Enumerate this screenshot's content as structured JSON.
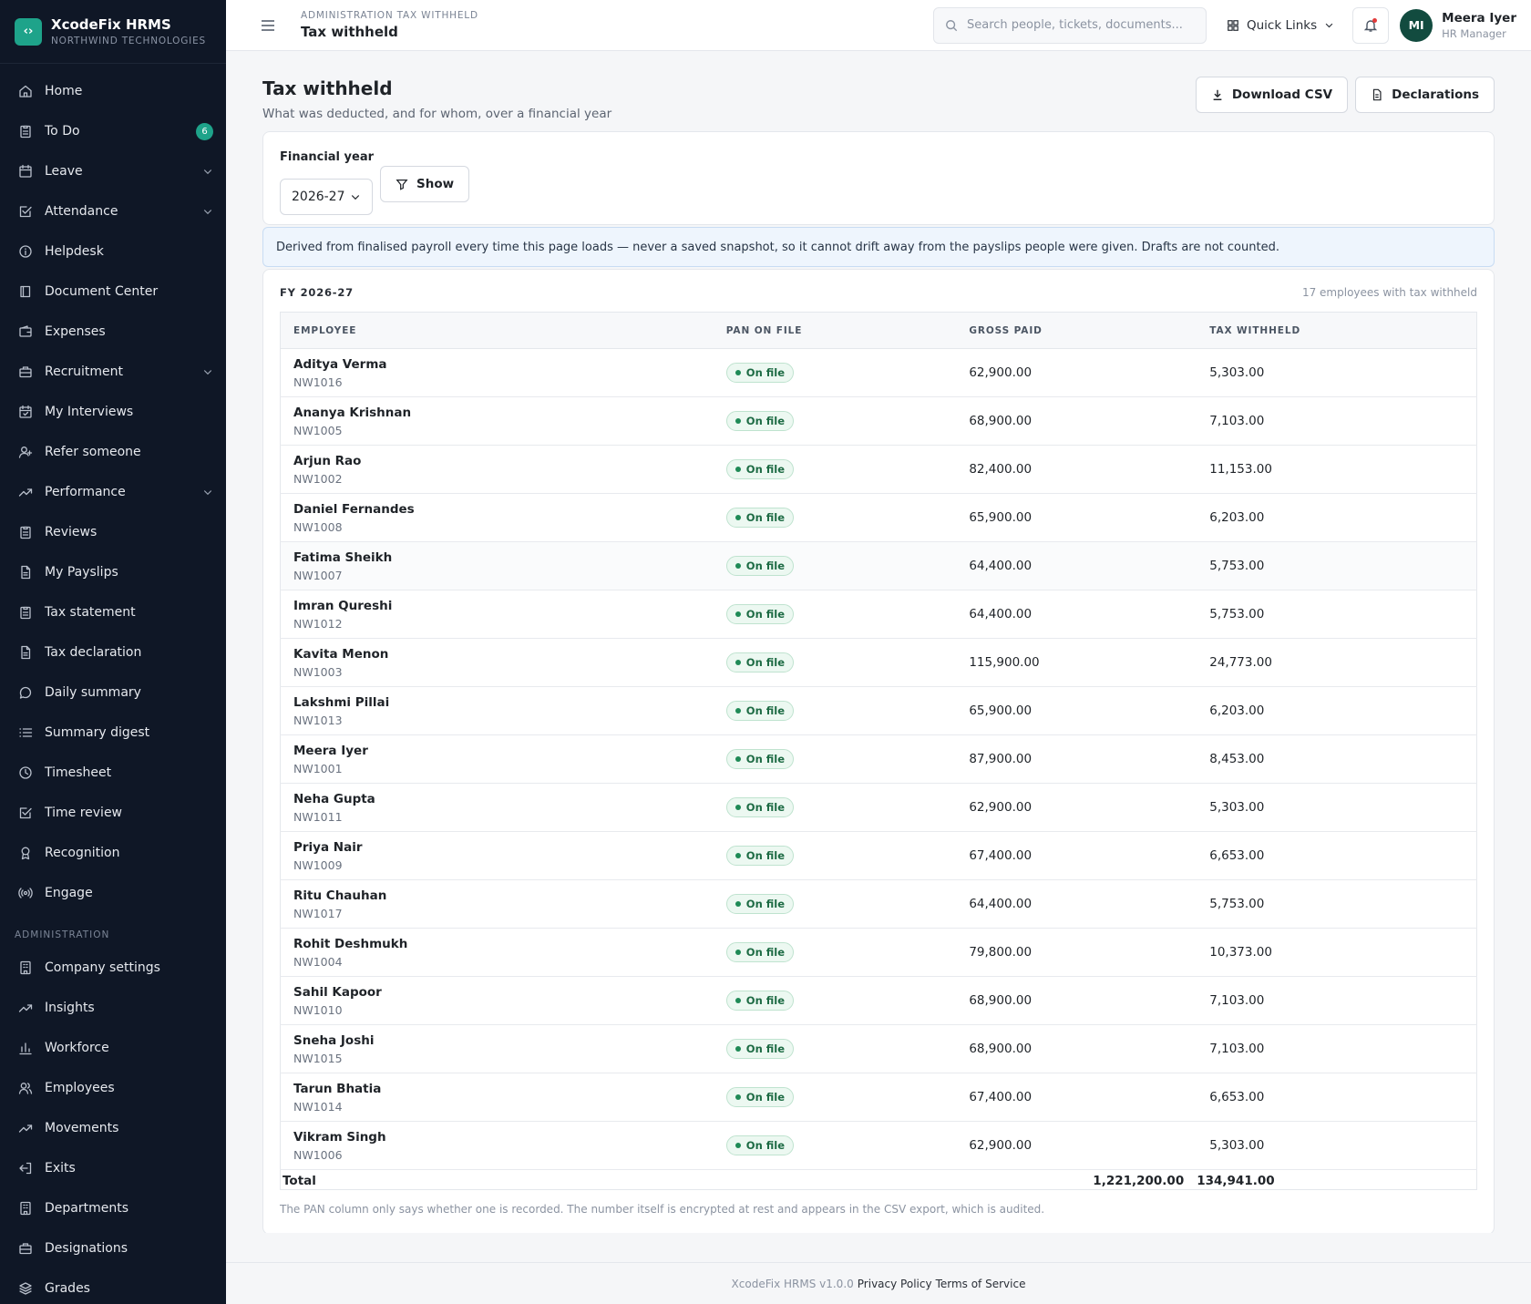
{
  "brand": {
    "logo": "‹›",
    "name": "XcodeFix HRMS",
    "org": "NORTHWIND TECHNOLOGIES"
  },
  "sidebar": {
    "items": [
      {
        "label": "Home",
        "icon": "home-icon"
      },
      {
        "label": "To Do",
        "icon": "clipboard-icon",
        "badge": "6"
      },
      {
        "label": "Leave",
        "icon": "calendar-icon",
        "chevron": true
      },
      {
        "label": "Attendance",
        "icon": "check-square-icon",
        "chevron": true
      },
      {
        "label": "Helpdesk",
        "icon": "info-icon"
      },
      {
        "label": "Document Center",
        "icon": "book-icon"
      },
      {
        "label": "Expenses",
        "icon": "wallet-icon"
      },
      {
        "label": "Recruitment",
        "icon": "briefcase-icon",
        "chevron": true
      },
      {
        "label": "My Interviews",
        "icon": "calendar-check-icon"
      },
      {
        "label": "Refer someone",
        "icon": "user-plus-icon"
      },
      {
        "label": "Performance",
        "icon": "trend-icon",
        "chevron": true
      },
      {
        "label": "Reviews",
        "icon": "clipboard-icon"
      },
      {
        "label": "My Payslips",
        "icon": "file-icon"
      },
      {
        "label": "Tax statement",
        "icon": "clipboard-icon"
      },
      {
        "label": "Tax declaration",
        "icon": "file-icon"
      },
      {
        "label": "Daily summary",
        "icon": "chat-icon"
      },
      {
        "label": "Summary digest",
        "icon": "list-icon"
      },
      {
        "label": "Timesheet",
        "icon": "clock-icon"
      },
      {
        "label": "Time review",
        "icon": "check-square-icon"
      },
      {
        "label": "Recognition",
        "icon": "award-icon"
      },
      {
        "label": "Engage",
        "icon": "broadcast-icon"
      }
    ],
    "admin_section": "ADMINISTRATION",
    "admin_items": [
      {
        "label": "Company settings",
        "icon": "building-icon"
      },
      {
        "label": "Insights",
        "icon": "trend-icon"
      },
      {
        "label": "Workforce",
        "icon": "bar-chart-icon"
      },
      {
        "label": "Employees",
        "icon": "users-icon"
      },
      {
        "label": "Movements",
        "icon": "trend-icon"
      },
      {
        "label": "Exits",
        "icon": "exit-icon"
      },
      {
        "label": "Departments",
        "icon": "building-icon"
      },
      {
        "label": "Designations",
        "icon": "briefcase-icon"
      },
      {
        "label": "Grades",
        "icon": "layers-icon"
      }
    ]
  },
  "topbar": {
    "crumb": "ADMINISTRATION TAX WITHHELD",
    "title": "Tax withheld",
    "search_placeholder": "Search people, tickets, documents...",
    "quick_links": "Quick Links",
    "user_initials": "MI",
    "user_name": "Meera Iyer",
    "user_role": "HR Manager"
  },
  "page": {
    "title": "Tax withheld",
    "subtitle": "What was deducted, and for whom, over a financial year",
    "download_csv": "Download CSV",
    "declarations": "Declarations"
  },
  "filter": {
    "label": "Financial year",
    "selected": "2026-27",
    "show": "Show"
  },
  "notice": "Derived from finalised payroll every time this page loads — never a saved snapshot, so it cannot drift away from the payslips people were given. Drafts are not counted.",
  "table": {
    "fy_label": "FY 2026-27",
    "count": "17 employees with tax withheld",
    "columns": [
      "EMPLOYEE",
      "PAN ON FILE",
      "GROSS PAID",
      "TAX WITHHELD"
    ],
    "rows": [
      {
        "name": "Aditya Verma",
        "id": "NW1016",
        "pan": "On file",
        "gross": "62,900.00",
        "tax": "5,303.00"
      },
      {
        "name": "Ananya Krishnan",
        "id": "NW1005",
        "pan": "On file",
        "gross": "68,900.00",
        "tax": "7,103.00"
      },
      {
        "name": "Arjun Rao",
        "id": "NW1002",
        "pan": "On file",
        "gross": "82,400.00",
        "tax": "11,153.00"
      },
      {
        "name": "Daniel Fernandes",
        "id": "NW1008",
        "pan": "On file",
        "gross": "65,900.00",
        "tax": "6,203.00"
      },
      {
        "name": "Fatima Sheikh",
        "id": "NW1007",
        "pan": "On file",
        "gross": "64,400.00",
        "tax": "5,753.00"
      },
      {
        "name": "Imran Qureshi",
        "id": "NW1012",
        "pan": "On file",
        "gross": "64,400.00",
        "tax": "5,753.00"
      },
      {
        "name": "Kavita Menon",
        "id": "NW1003",
        "pan": "On file",
        "gross": "115,900.00",
        "tax": "24,773.00"
      },
      {
        "name": "Lakshmi Pillai",
        "id": "NW1013",
        "pan": "On file",
        "gross": "65,900.00",
        "tax": "6,203.00"
      },
      {
        "name": "Meera Iyer",
        "id": "NW1001",
        "pan": "On file",
        "gross": "87,900.00",
        "tax": "8,453.00"
      },
      {
        "name": "Neha Gupta",
        "id": "NW1011",
        "pan": "On file",
        "gross": "62,900.00",
        "tax": "5,303.00"
      },
      {
        "name": "Priya Nair",
        "id": "NW1009",
        "pan": "On file",
        "gross": "67,400.00",
        "tax": "6,653.00"
      },
      {
        "name": "Ritu Chauhan",
        "id": "NW1017",
        "pan": "On file",
        "gross": "64,400.00",
        "tax": "5,753.00"
      },
      {
        "name": "Rohit Deshmukh",
        "id": "NW1004",
        "pan": "On file",
        "gross": "79,800.00",
        "tax": "10,373.00"
      },
      {
        "name": "Sahil Kapoor",
        "id": "NW1010",
        "pan": "On file",
        "gross": "68,900.00",
        "tax": "7,103.00"
      },
      {
        "name": "Sneha Joshi",
        "id": "NW1015",
        "pan": "On file",
        "gross": "68,900.00",
        "tax": "7,103.00"
      },
      {
        "name": "Tarun Bhatia",
        "id": "NW1014",
        "pan": "On file",
        "gross": "67,400.00",
        "tax": "6,653.00"
      },
      {
        "name": "Vikram Singh",
        "id": "NW1006",
        "pan": "On file",
        "gross": "62,900.00",
        "tax": "5,303.00"
      }
    ],
    "total_label": "Total",
    "total_gross": "1,221,200.00",
    "total_tax": "134,941.00",
    "note": "The PAN column only says whether one is recorded. The number itself is encrypted at rest and appears in the CSV export, which is audited."
  },
  "footer": {
    "version": "XcodeFix HRMS v1.0.0",
    "privacy": "Privacy Policy",
    "terms": "Terms of Service"
  },
  "colors": {
    "sidebar_bg": "#0f1726",
    "accent": "#1ea38a",
    "notice_bg": "#eef5fd",
    "pill_green": "#1d6b44"
  }
}
